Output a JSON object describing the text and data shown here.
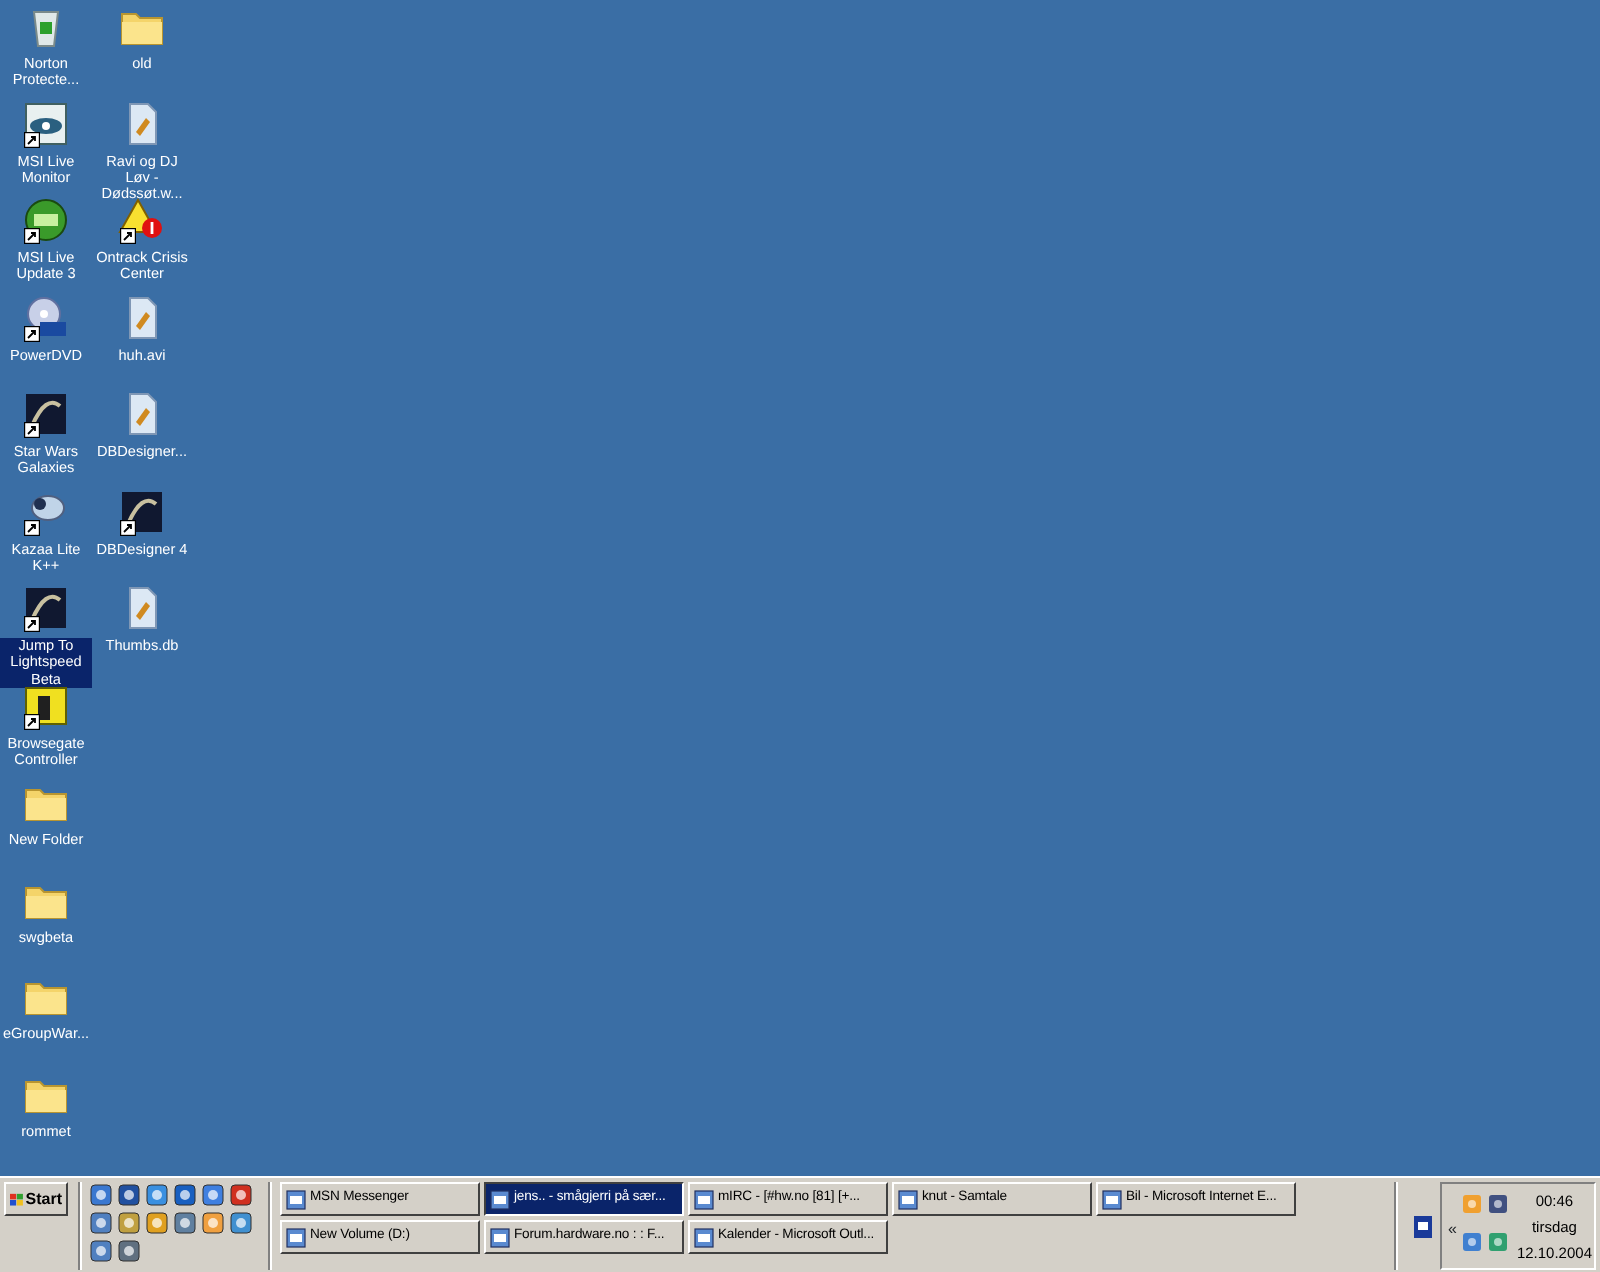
{
  "desktop_columns": [
    [
      {
        "label": "Norton Protecte...",
        "kind": "bin",
        "shortcut": false,
        "selected": false
      },
      {
        "label": "MSI Live Monitor",
        "kind": "eye",
        "shortcut": true,
        "selected": false
      },
      {
        "label": "MSI Live Update 3",
        "kind": "live",
        "shortcut": true,
        "selected": false
      },
      {
        "label": "PowerDVD",
        "kind": "disc",
        "shortcut": true,
        "selected": false
      },
      {
        "label": "Star Wars Galaxies",
        "kind": "dark",
        "shortcut": true,
        "selected": false
      },
      {
        "label": "Kazaa Lite K++",
        "kind": "app",
        "shortcut": true,
        "selected": false
      },
      {
        "label": "Jump To Lightspeed Beta",
        "kind": "dark",
        "shortcut": true,
        "selected": true
      },
      {
        "label": "Browsegate Controller",
        "kind": "yellow",
        "shortcut": true,
        "selected": false
      },
      {
        "label": "New Folder",
        "kind": "folder",
        "shortcut": false,
        "selected": false
      },
      {
        "label": "swgbeta",
        "kind": "folder",
        "shortcut": false,
        "selected": false
      },
      {
        "label": "eGroupWar...",
        "kind": "folder",
        "shortcut": false,
        "selected": false
      },
      {
        "label": "rommet",
        "kind": "folder",
        "shortcut": false,
        "selected": false
      }
    ],
    [
      {
        "label": "old",
        "kind": "folder",
        "shortcut": false,
        "selected": false
      },
      {
        "label": "Ravi og DJ Løv - Dødssøt.w...",
        "kind": "file",
        "shortcut": false,
        "selected": false
      },
      {
        "label": "Ontrack Crisis Center",
        "kind": "warning",
        "shortcut": true,
        "selected": false
      },
      {
        "label": "huh.avi",
        "kind": "file",
        "shortcut": false,
        "selected": false
      },
      {
        "label": "DBDesigner...",
        "kind": "file",
        "shortcut": false,
        "selected": false
      },
      {
        "label": "DBDesigner 4",
        "kind": "dark",
        "shortcut": true,
        "selected": false
      },
      {
        "label": "Thumbs.db",
        "kind": "file",
        "shortcut": false,
        "selected": false
      }
    ]
  ],
  "taskbar": {
    "start": "Start",
    "tasks": [
      {
        "label": "MSN Messenger",
        "selected": false
      },
      {
        "label": "jens.. - smågjerri på sær...",
        "selected": true
      },
      {
        "label": "mIRC - [#hw.no [81] [+...",
        "selected": false
      },
      {
        "label": "knut - Samtale",
        "selected": false
      },
      {
        "label": "Bil - Microsoft Internet E...",
        "selected": false
      },
      {
        "label": "New Volume (D:)",
        "selected": false
      },
      {
        "label": "Forum.hardware.no : : F...",
        "selected": false
      },
      {
        "label": "Kalender - Microsoft Outl...",
        "selected": false
      }
    ],
    "tray": {
      "expand": "«",
      "time": "00:46",
      "day": "tirsdag",
      "date": "12.10.2004"
    }
  }
}
